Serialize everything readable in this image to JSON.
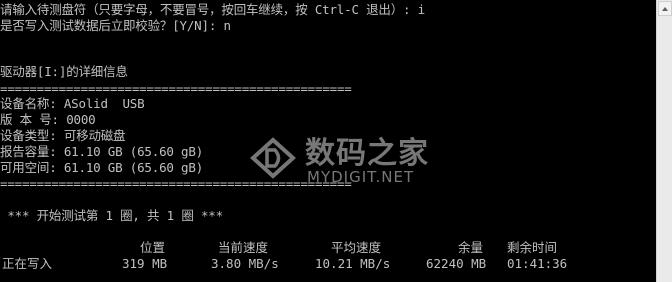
{
  "console": {
    "prompt_drive": "请输入待测盘符（只要字母，不要冒号，按回车继续，按 Ctrl-C 退出）: i",
    "prompt_verify": "是否写入测试数据后立即校验？[Y/N]: n",
    "drive_title": "驱动器[I:]的详细信息",
    "separator_top": "================================================",
    "device_name": "设备名称: ASolid  USB",
    "version": "版 本 号: 0000",
    "device_type": "设备类型: 可移动磁盘",
    "reported_capacity": "报告容量: 61.10 GB (65.60 gB)",
    "available_space": "可用空间: 61.10 GB (65.60 gB)",
    "separator_bottom": "================================================",
    "test_round": " *** 开始测试第 1 圈, 共 1 圈 ***"
  },
  "progress_table": {
    "headers": {
      "position": "位置",
      "current_speed": "当前速度",
      "average_speed": "平均速度",
      "remaining": "余量",
      "remaining_time": "剩余时间"
    },
    "row": {
      "status": "正在写入",
      "position": "319 MB",
      "current_speed": "3.80 MB/s",
      "average_speed": "10.21 MB/s",
      "remaining": "62240 MB",
      "remaining_time": "01:41:36"
    }
  },
  "watermark": {
    "brand": "数码之家",
    "url": "MYDIGIT.NET",
    "logo_icon": "mydigit-logo-icon"
  },
  "colors": {
    "console_bg": "#000000",
    "console_fg": "#c0c0c0",
    "scrollbar_bg": "#eaeaea"
  }
}
